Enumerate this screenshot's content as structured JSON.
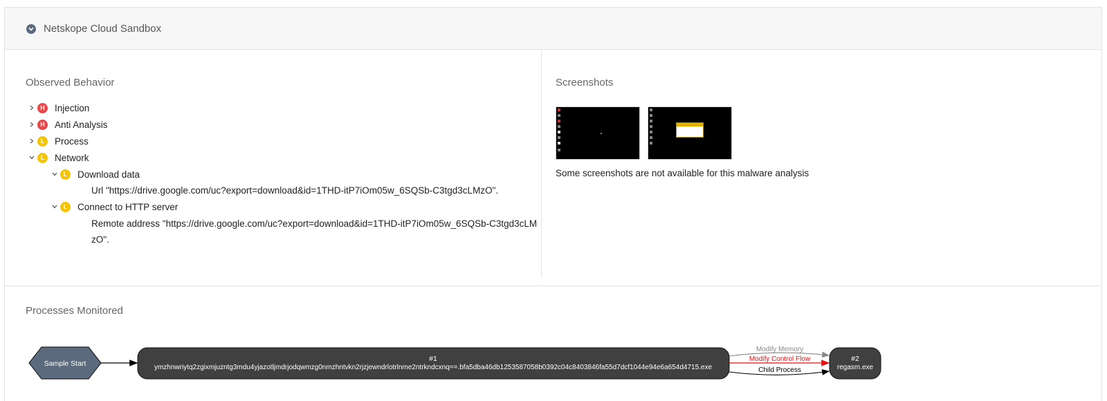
{
  "panel": {
    "title": "Netskope Cloud Sandbox",
    "collapse_icon": "chevron-circle-down-icon"
  },
  "observed": {
    "title": "Observed Behavior",
    "items": [
      {
        "label": "Injection",
        "severity": "H",
        "expanded": false
      },
      {
        "label": "Anti Analysis",
        "severity": "H",
        "expanded": false
      },
      {
        "label": "Process",
        "severity": "L",
        "expanded": false
      },
      {
        "label": "Network",
        "severity": "L",
        "expanded": true,
        "children": [
          {
            "label": "Download data",
            "severity": "L",
            "expanded": true,
            "detail": "Url \"https://drive.google.com/uc?export=download&id=1THD-itP7iOm05w_6SQSb-C3tgd3cLMzO\"."
          },
          {
            "label": "Connect to HTTP server",
            "severity": "L",
            "expanded": true,
            "detail_line1": "Remote address \"https://drive.google.com/uc?export=download&id=1THD-itP7iOm05w_6SQSb-C3tgd3cLM",
            "detail_line2": "zO\"."
          }
        ]
      }
    ]
  },
  "screenshots": {
    "title": "Screenshots",
    "note": "Some screenshots are not available for this malware analysis"
  },
  "processes": {
    "title": "Processes Monitored",
    "start_node": "Sample Start",
    "node1_id": "#1",
    "node1_name": "ymzhnwriytq2zgixmjuzntg3mdu4yjazotljmdrjodqwmzg0nmzhntvkn2rjzjewndrlotrlnme2ntrkndcxnq==.bfa5dba46db1253587058b0392c04c8403846fa55d7dcf1044e94e6a654d4715.exe",
    "node2_id": "#2",
    "node2_name": "regasm.exe",
    "edges": [
      "Modify Memory",
      "Modify Control Flow",
      "Child Process"
    ],
    "colors": {
      "node": "#404040",
      "start": "#5b6b7d",
      "memory": "#888888",
      "control_flow": "#e81010",
      "child": "#000000"
    }
  }
}
